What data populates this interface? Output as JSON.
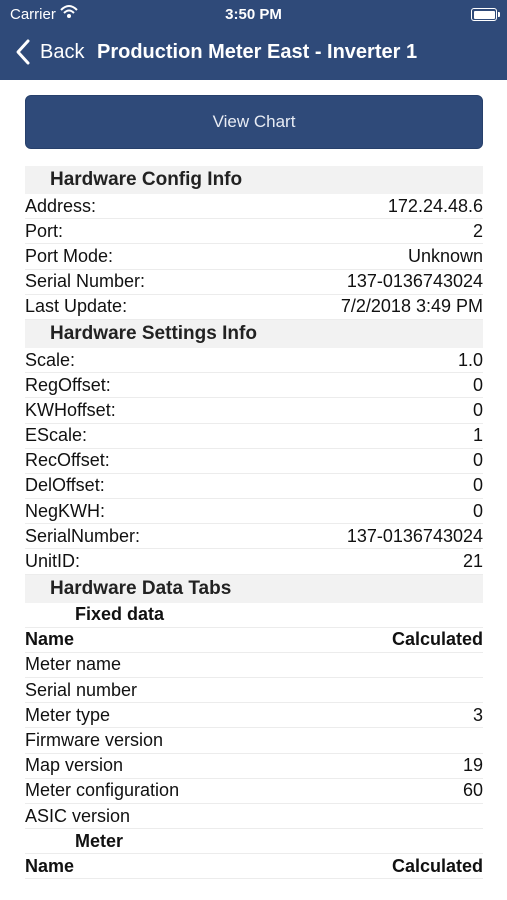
{
  "status": {
    "carrier": "Carrier",
    "time": "3:50 PM"
  },
  "nav": {
    "back_label": "Back",
    "title": "Production Meter East - Inverter 1"
  },
  "view_chart_label": "View Chart",
  "config": {
    "header": "Hardware Config Info",
    "rows": [
      {
        "label": "Address:",
        "value": "172.24.48.6"
      },
      {
        "label": "Port:",
        "value": "2"
      },
      {
        "label": "Port Mode:",
        "value": "Unknown"
      },
      {
        "label": "Serial Number:",
        "value": "137-0136743024"
      },
      {
        "label": "Last Update:",
        "value": "7/2/2018 3:49 PM"
      }
    ]
  },
  "settings": {
    "header": "Hardware Settings Info",
    "rows": [
      {
        "label": "Scale:",
        "value": "1.0"
      },
      {
        "label": "RegOffset:",
        "value": "0"
      },
      {
        "label": "KWHoffset:",
        "value": "0"
      },
      {
        "label": "EScale:",
        "value": "1"
      },
      {
        "label": "RecOffset:",
        "value": "0"
      },
      {
        "label": "DelOffset:",
        "value": "0"
      },
      {
        "label": "NegKWH:",
        "value": "0"
      },
      {
        "label": "SerialNumber:",
        "value": "137-0136743024"
      },
      {
        "label": "UnitID:",
        "value": "21"
      }
    ]
  },
  "data_tabs": {
    "header": "Hardware Data Tabs",
    "fixed": {
      "title": "Fixed data",
      "col_name": "Name",
      "col_value": "Calculated",
      "rows": [
        {
          "label": "Meter name",
          "value": ""
        },
        {
          "label": "Serial number",
          "value": ""
        },
        {
          "label": "Meter type",
          "value": "3"
        },
        {
          "label": "Firmware version",
          "value": ""
        },
        {
          "label": "Map version",
          "value": "19"
        },
        {
          "label": "Meter configuration",
          "value": "60"
        },
        {
          "label": "ASIC version",
          "value": ""
        }
      ]
    },
    "meter": {
      "title": "Meter",
      "col_name": "Name",
      "col_value": "Calculated"
    }
  }
}
